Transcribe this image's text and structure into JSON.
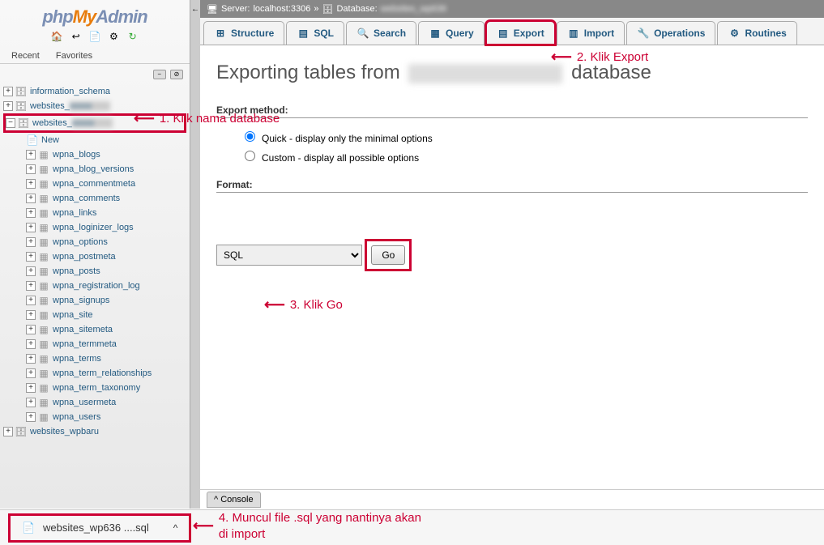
{
  "logo": {
    "php": "php",
    "my": "My",
    "admin": "Admin"
  },
  "nav_tabs": [
    "Recent",
    "Favorites"
  ],
  "breadcrumb": {
    "server_label": "Server:",
    "server": "localhost:3306",
    "db_label": "Database:",
    "db": "websites_wp636"
  },
  "tabs": [
    {
      "label": "Structure",
      "icon": "⊞"
    },
    {
      "label": "SQL",
      "icon": "▤"
    },
    {
      "label": "Search",
      "icon": "🔍"
    },
    {
      "label": "Query",
      "icon": "▦"
    },
    {
      "label": "Export",
      "icon": "▤",
      "highlight": true
    },
    {
      "label": "Import",
      "icon": "▥"
    },
    {
      "label": "Operations",
      "icon": "🔧"
    },
    {
      "label": "Routines",
      "icon": "⚙"
    }
  ],
  "page_title_pre": "Exporting tables from",
  "page_title_post": "database",
  "export_method": {
    "heading": "Export method:",
    "quick": "Quick - display only the minimal options",
    "custom": "Custom - display all possible options"
  },
  "format": {
    "heading": "Format:",
    "value": "SQL"
  },
  "go": "Go",
  "console": "Console",
  "tree": {
    "dbs": [
      "information_schema",
      "websites_",
      "websites_",
      "websites_wpbaru"
    ],
    "selected_idx": 2,
    "new_label": "New",
    "tables": [
      "wpna_blogs",
      "wpna_blog_versions",
      "wpna_commentmeta",
      "wpna_comments",
      "wpna_links",
      "wpna_loginizer_logs",
      "wpna_options",
      "wpna_postmeta",
      "wpna_posts",
      "wpna_registration_log",
      "wpna_signups",
      "wpna_site",
      "wpna_sitemeta",
      "wpna_termmeta",
      "wpna_terms",
      "wpna_term_relationships",
      "wpna_term_taxonomy",
      "wpna_usermeta",
      "wpna_users"
    ]
  },
  "download": {
    "filename": "websites_wp636 ....sql"
  },
  "annotations": {
    "a1": "1. Klik nama database",
    "a2": "2. Klik Export",
    "a3": "3. Klik Go",
    "a4": "4. Muncul file .sql yang nantinya akan di import"
  }
}
